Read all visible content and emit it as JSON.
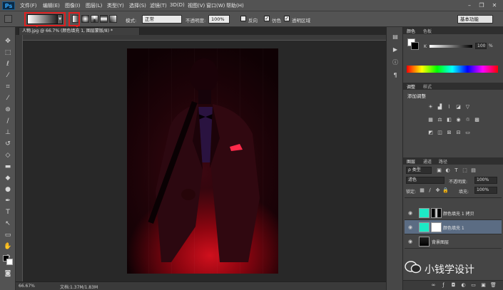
{
  "app": {
    "logo": "Ps"
  },
  "menu": [
    "文件(F)",
    "编辑(E)",
    "图像(I)",
    "图层(L)",
    "类型(Y)",
    "选择(S)",
    "滤镜(T)",
    "3D(D)",
    "视图(V)",
    "窗口(W)",
    "帮助(H)"
  ],
  "window_controls": [
    "–",
    "❐",
    "✕"
  ],
  "options": {
    "mode_label": "模式:",
    "mode_value": "正常",
    "opacity_label": "不透明度:",
    "opacity_value": "100%",
    "reverse_label": "反向",
    "dither_label": "仿色",
    "transparency_label": "透明区域",
    "workspace_value": "基本功能"
  },
  "document": {
    "tab_title": "人物.jpg @ 66.7% (颜色填充 1, 图层蒙版/8) *",
    "zoom": "66.67%",
    "doc_size": "文档:1.37M/1.83M"
  },
  "panels": {
    "color_tabs": [
      "颜色",
      "色板"
    ],
    "k_label": "K",
    "k_value": "100",
    "k_unit": "%",
    "adjust_tabs": [
      "调整",
      "样式"
    ],
    "adjust_title": "添加调整",
    "layers_tabs": [
      "图层",
      "通道",
      "路径"
    ],
    "filter_kind": "ρ 类型",
    "blend_mode": "滤色",
    "opacity_label": "不透明度:",
    "opacity_value": "100%",
    "lock_label": "锁定:",
    "fill_label": "填充:",
    "fill_value": "100%"
  },
  "layers": [
    {
      "name": "颜色填充 1 拷贝",
      "selected": false
    },
    {
      "name": "颜色填充 1",
      "selected": true
    },
    {
      "name": "背景图层",
      "selected": false
    }
  ],
  "watermark": {
    "text": "小钱学设计"
  },
  "colors": {
    "fill_layer": "#1de9c6",
    "highlight_red": "#e02020",
    "selected_row": "#5b6c83"
  }
}
